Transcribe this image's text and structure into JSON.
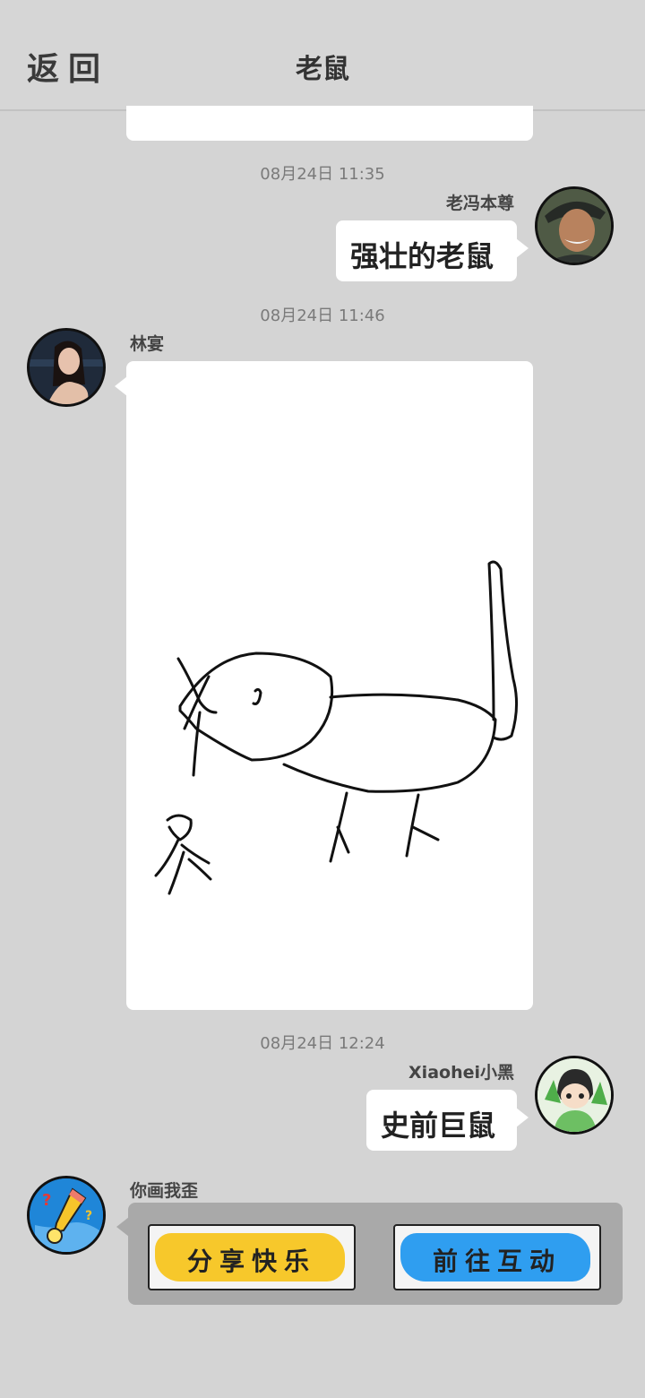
{
  "header": {
    "back_label": "返回",
    "title": "老鼠"
  },
  "messages": [
    {
      "time": "08月24日 11:35",
      "user": "老冯本尊",
      "text": "强壮的老鼠"
    },
    {
      "time": "08月24日 11:46",
      "user": "林宴"
    },
    {
      "time": "08月24日 12:24",
      "user": "Xiaohei小黑",
      "text": "史前巨鼠"
    },
    {
      "user": "你画我歪"
    }
  ],
  "card": {
    "share_label": "分享快乐",
    "share_color": "#f7c82b",
    "interact_label": "前往互动",
    "interact_color": "#2f9ef0"
  }
}
